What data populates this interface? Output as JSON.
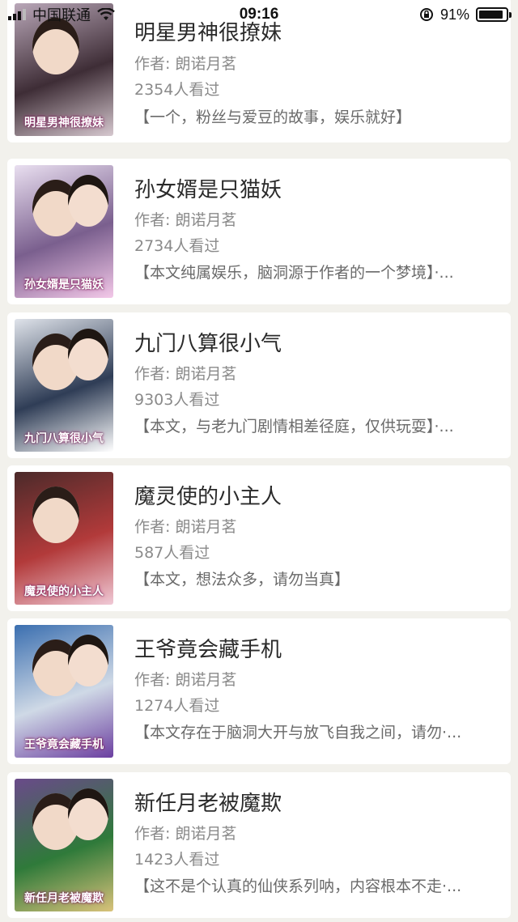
{
  "status_bar": {
    "carrier": "中国联通",
    "time": "09:16",
    "battery_text": "91%",
    "battery_level": 0.91
  },
  "books": [
    {
      "title": "明星男神很撩妹",
      "author": "作者: 朗诺月茗",
      "views": "2354人看过",
      "desc": "【一个，粉丝与爱豆的故事，娱乐就好】",
      "cover_text": "明星男神很撩妹",
      "cover_colors": [
        "#b9a7b8",
        "#3e2d36",
        "#d6c8cf"
      ]
    },
    {
      "title": "孙女婿是只猫妖",
      "author": "作者: 朗诺月茗",
      "views": "2734人看过",
      "desc": "【本文纯属娱乐，脑洞源于作者的一个梦境】·...",
      "cover_text": "孙女婿是只猫妖",
      "cover_colors": [
        "#e9dff0",
        "#7a5f8e",
        "#f3c8e8"
      ]
    },
    {
      "title": "九门八算很小气",
      "author": "作者: 朗诺月茗",
      "views": "9303人看过",
      "desc": "【本文，与老九门剧情相差径庭，仅供玩耍】·...",
      "cover_text": "九门八算很小气",
      "cover_colors": [
        "#dfe3ea",
        "#2f3d56",
        "#ffffff"
      ]
    },
    {
      "title": "魔灵使的小主人",
      "author": "作者: 朗诺月茗",
      "views": "587人看过",
      "desc": "【本文，想法众多，请勿当真】",
      "cover_text": "魔灵使的小主人",
      "cover_colors": [
        "#4b2a2a",
        "#b23a3a",
        "#f0c9d6"
      ]
    },
    {
      "title": "王爷竟会藏手机",
      "author": "作者: 朗诺月茗",
      "views": "1274人看过",
      "desc": "【本文存在于脑洞大开与放飞自我之间，请勿·...",
      "cover_text": "王爷竟会藏手机",
      "cover_colors": [
        "#3b6fb0",
        "#cfd9e6",
        "#6b3fa0"
      ]
    },
    {
      "title": "新任月老被魔欺",
      "author": "作者: 朗诺月茗",
      "views": "1423人看过",
      "desc": "【这不是个认真的仙侠系列呐，内容根本不走·...",
      "cover_text": "新任月老被魔欺",
      "cover_colors": [
        "#6a4a8a",
        "#2f7a3a",
        "#d9c27a"
      ]
    }
  ]
}
